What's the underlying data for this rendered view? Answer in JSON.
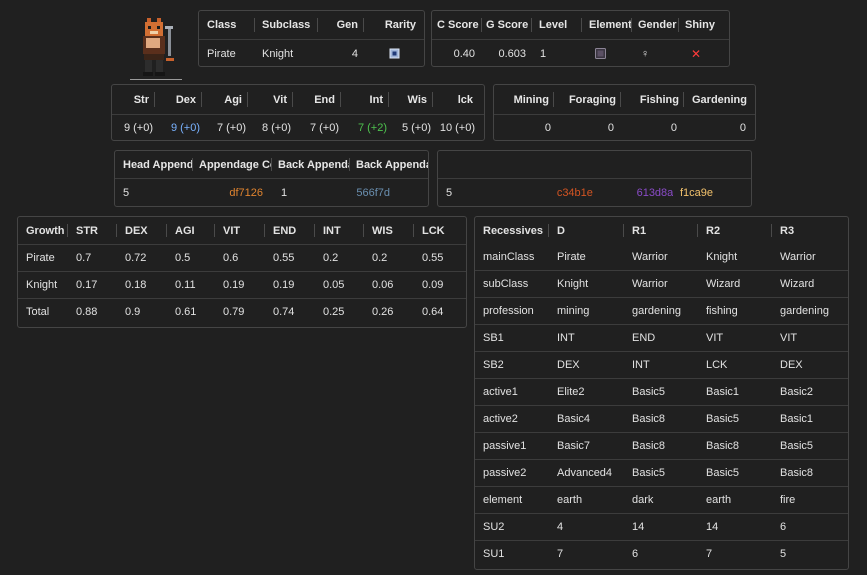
{
  "identity": {
    "headers": [
      "Class",
      "Subclass",
      "Gen",
      "Rarity"
    ],
    "values": {
      "class": "Pirate",
      "subclass": "Knight",
      "gen": "4",
      "rarity_icon": "rarity-gem-icon"
    }
  },
  "scores": {
    "headers": [
      "C Score",
      "G Score",
      "Level",
      "Element",
      "Gender",
      "Shiny"
    ],
    "values": {
      "c_score": "0.40",
      "g_score": "0.603",
      "level": "1",
      "element_icon": "element-swatch-icon",
      "gender": "♀",
      "shiny": "✕"
    }
  },
  "stats": {
    "headers": [
      "Str",
      "Dex",
      "Agi",
      "Vit",
      "End",
      "Int",
      "Wis",
      "lck"
    ],
    "values": [
      "9 (+0)",
      "9 (+0)",
      "7 (+0)",
      "8 (+0)",
      "7 (+0)",
      "7 (+2)",
      "5 (+0)",
      "10 (+0)"
    ]
  },
  "professions": {
    "headers": [
      "Mining",
      "Foraging",
      "Fishing",
      "Gardening"
    ],
    "values": [
      "0",
      "0",
      "0",
      "0"
    ]
  },
  "appendages": {
    "headers": [
      "Head Appendage",
      "Appendage Color",
      "Back Appendage",
      "Back Appendage Color"
    ],
    "values": [
      "5",
      "df7126",
      "1",
      "566f7d"
    ]
  },
  "hair": {
    "values": [
      "5",
      "c34b1e",
      "613d8a",
      "f1ca9e"
    ]
  },
  "growth": {
    "headers": [
      "Growth",
      "STR",
      "DEX",
      "AGI",
      "VIT",
      "END",
      "INT",
      "WIS",
      "LCK"
    ],
    "rows": [
      [
        "Pirate",
        "0.7",
        "0.72",
        "0.5",
        "0.6",
        "0.55",
        "0.2",
        "0.2",
        "0.55"
      ],
      [
        "Knight",
        "0.17",
        "0.18",
        "0.11",
        "0.19",
        "0.19",
        "0.05",
        "0.06",
        "0.09"
      ],
      [
        "Total",
        "0.88",
        "0.9",
        "0.61",
        "0.79",
        "0.74",
        "0.25",
        "0.26",
        "0.64"
      ]
    ]
  },
  "recessives": {
    "headers": [
      "Recessives",
      "D",
      "R1",
      "R2",
      "R3"
    ],
    "rows": [
      [
        "mainClass",
        "Pirate",
        "Warrior",
        "Knight",
        "Warrior"
      ],
      [
        "subClass",
        "Knight",
        "Warrior",
        "Wizard",
        "Wizard"
      ],
      [
        "profession",
        "mining",
        "gardening",
        "fishing",
        "gardening"
      ],
      [
        "SB1",
        "INT",
        "END",
        "VIT",
        "VIT"
      ],
      [
        "SB2",
        "DEX",
        "INT",
        "LCK",
        "DEX"
      ],
      [
        "active1",
        "Elite2",
        "Basic5",
        "Basic1",
        "Basic2"
      ],
      [
        "active2",
        "Basic4",
        "Basic8",
        "Basic5",
        "Basic1"
      ],
      [
        "passive1",
        "Basic7",
        "Basic8",
        "Basic8",
        "Basic5"
      ],
      [
        "passive2",
        "Advanced4",
        "Basic5",
        "Basic5",
        "Basic8"
      ],
      [
        "element",
        "earth",
        "dark",
        "earth",
        "fire"
      ],
      [
        "SU2",
        "4",
        "14",
        "14",
        "6"
      ],
      [
        "SU1",
        "7",
        "6",
        "7",
        "5"
      ]
    ]
  },
  "colors": {
    "dex_value": "#79b2ff",
    "int_value": "#4ec24e",
    "appendage_color": "#df7126",
    "back_appendage_color": "#566f7d",
    "hair_1": "#c34b1e",
    "hair_2": "#613d8a",
    "hair_3": "#f1ca9e",
    "shiny_x": "#ff3b3b"
  }
}
